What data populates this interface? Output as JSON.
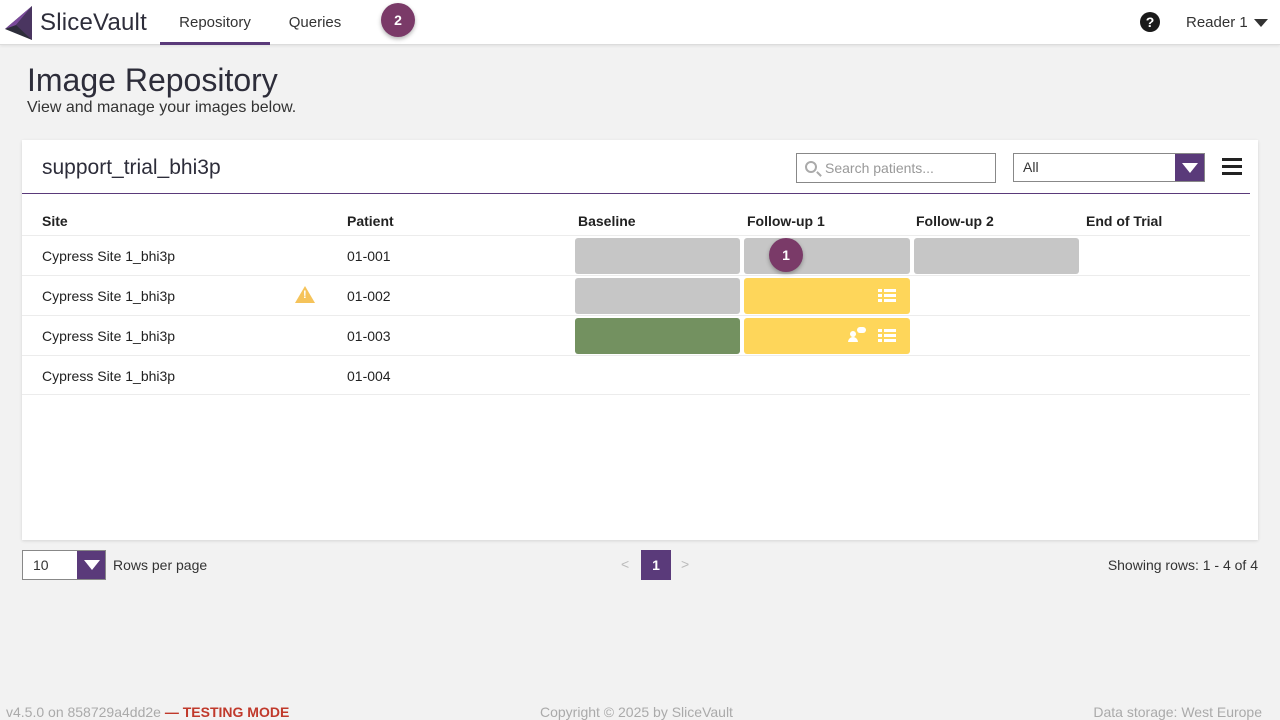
{
  "app": {
    "name": "SliceVault"
  },
  "nav": {
    "tabs": [
      {
        "label": "Repository",
        "active": true
      },
      {
        "label": "Queries",
        "active": false
      }
    ],
    "queries_badge": "2",
    "user": "Reader 1"
  },
  "page": {
    "title": "Image Repository",
    "subtitle": "View and manage your images below."
  },
  "card": {
    "title": "support_trial_bhi3p",
    "search_placeholder": "Search patients...",
    "filter_value": "All"
  },
  "table": {
    "headers": [
      "Site",
      "Patient",
      "Baseline",
      "Follow-up 1",
      "Follow-up 2",
      "End of Trial"
    ],
    "rows": [
      {
        "site": "Cypress Site 1_bhi3p",
        "patient": "01-001",
        "warning": false,
        "visits": {
          "baseline": "gray",
          "followup1": "gray",
          "followup2": "gray",
          "end_of_trial": ""
        },
        "followup1_badge": "1"
      },
      {
        "site": "Cypress Site 1_bhi3p",
        "patient": "01-002",
        "warning": true,
        "visits": {
          "baseline": "gray",
          "followup1": "yellow",
          "followup2": "",
          "end_of_trial": ""
        }
      },
      {
        "site": "Cypress Site 1_bhi3p",
        "patient": "01-003",
        "warning": false,
        "visits": {
          "baseline": "green",
          "followup1": "yellow",
          "followup2": "",
          "end_of_trial": ""
        }
      },
      {
        "site": "Cypress Site 1_bhi3p",
        "patient": "01-004",
        "warning": false,
        "visits": {
          "baseline": "",
          "followup1": "",
          "followup2": "",
          "end_of_trial": ""
        }
      }
    ]
  },
  "pagination": {
    "rows_per_page": "10",
    "rows_per_page_label": "Rows per page",
    "prev": "<",
    "current_page": "1",
    "next": ">",
    "showing": "Showing rows: 1 - 4 of 4"
  },
  "footer": {
    "version": "v4.5.0 on 858729a4dd2e",
    "mode": "— TESTING MODE",
    "copyright": "Copyright © 2025 by SliceVault",
    "storage": "Data storage: West Europe"
  },
  "colors": {
    "brand": "#5a3a7a",
    "badge": "#7a3a68",
    "status_gray": "#c6c6c6",
    "status_yellow": "#fed65a",
    "status_green": "#739160",
    "warning": "#f5c35a",
    "testing_mode": "#c0392b"
  },
  "icons": {
    "logo": "slicevault-logo-icon",
    "help": "question-circle-icon",
    "user_menu": "caret-down-icon",
    "search": "search-icon",
    "menu": "hamburger-menu-icon",
    "warning": "warning-triangle-icon",
    "list": "list-icon",
    "comment": "user-comment-icon"
  }
}
